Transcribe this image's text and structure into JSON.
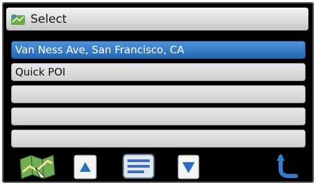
{
  "title_bar": {
    "title": "Select",
    "icon": "map-icon"
  },
  "list": {
    "items": [
      {
        "label": "Van Ness Ave, San Francisco, CA",
        "selected": true
      },
      {
        "label": "Quick POI",
        "selected": false
      },
      {
        "label": "",
        "selected": false
      },
      {
        "label": "",
        "selected": false
      },
      {
        "label": "",
        "selected": false
      }
    ]
  },
  "toolbar": {
    "buttons": [
      "map-icon",
      "scroll-up-arrow-icon",
      "list-details-icon",
      "scroll-down-arrow-icon",
      "back-icon"
    ]
  },
  "colors": {
    "selected_row": "#3478c8",
    "row": "#d8d8d8",
    "background": "#000000",
    "arrow_blue": "#2a6fc0"
  }
}
